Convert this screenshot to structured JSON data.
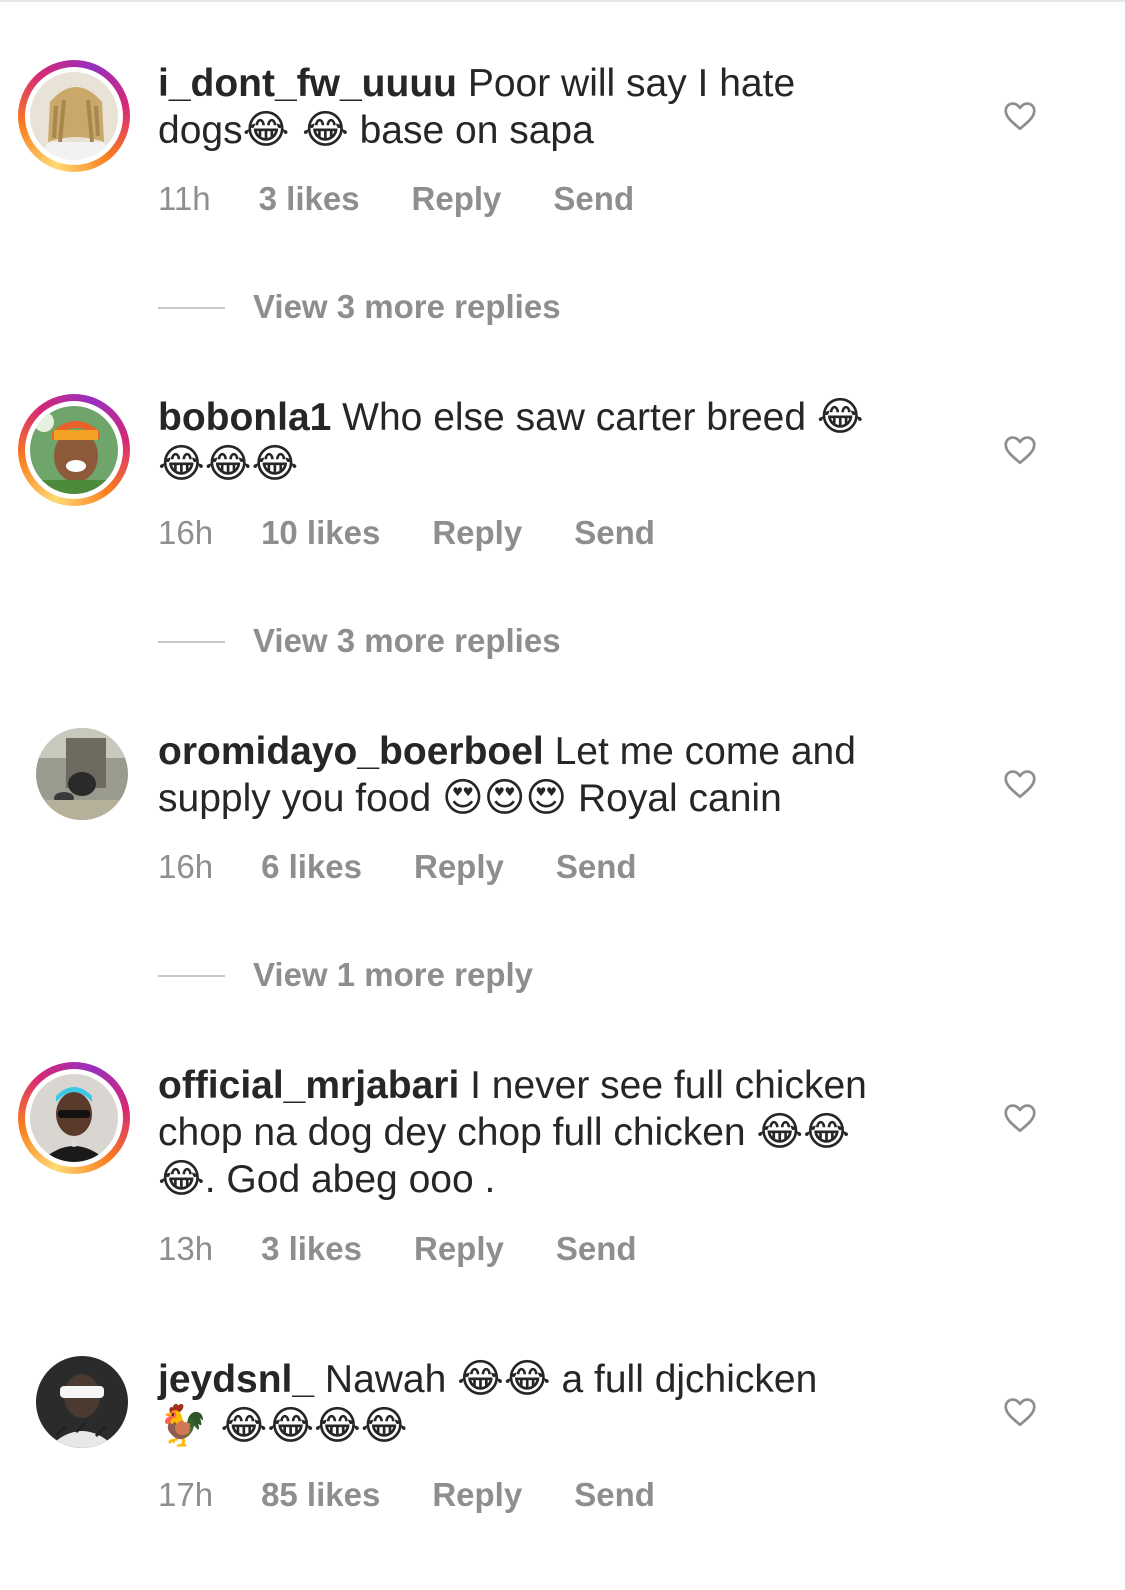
{
  "comments": [
    {
      "username": "i_dont_fw_uuuu",
      "line1_text": " Poor will say I hate",
      "line2_text": "dogs",
      "line2_emojis": "😂 😂",
      "line2_tail": " base on sapa",
      "time": "11h",
      "likes": "3 likes",
      "reply": "Reply",
      "send": "Send",
      "view_replies": "View 3 more replies",
      "has_story_ring": true
    },
    {
      "username": "bobonla1",
      "line1_text": " Who else saw carter breed ",
      "line1_emojis": "😂",
      "line2_emojis": "😂😂😂",
      "time": "16h",
      "likes": "10 likes",
      "reply": "Reply",
      "send": "Send",
      "view_replies": "View 3 more replies",
      "has_story_ring": true
    },
    {
      "username": "oromidayo_boerboel",
      "line1_text": " Let me come and",
      "line2_text": "supply you food ",
      "line2_emojis": "😍😍😍",
      "line2_tail": " Royal canin",
      "time": "16h",
      "likes": "6 likes",
      "reply": "Reply",
      "send": "Send",
      "view_replies": "View 1 more reply",
      "has_story_ring": false
    },
    {
      "username": "official_mrjabari",
      "line1_text": " I never see full chicken",
      "line2_text": "chop na dog dey chop full chicken ",
      "line2_emojis": "😂😂",
      "line3_emojis": "😂",
      "line3_text": ". God abeg ooo .",
      "time": "13h",
      "likes": "3 likes",
      "reply": "Reply",
      "send": "Send",
      "has_story_ring": true
    },
    {
      "username": "jeydsnl_",
      "line1_text": " Nawah ",
      "line1_emojis": "😂😂",
      "line1_tail": " a full djchicken",
      "line2_emojis": "🐓 😂😂😂😂",
      "time": "17h",
      "likes": "85 likes",
      "reply": "Reply",
      "send": "Send",
      "has_story_ring": false
    }
  ],
  "icons": {
    "like": "heart-outline-icon"
  },
  "colors": {
    "text": "#262626",
    "secondary": "#8e8e8e",
    "divider": "#c7c7c7"
  }
}
